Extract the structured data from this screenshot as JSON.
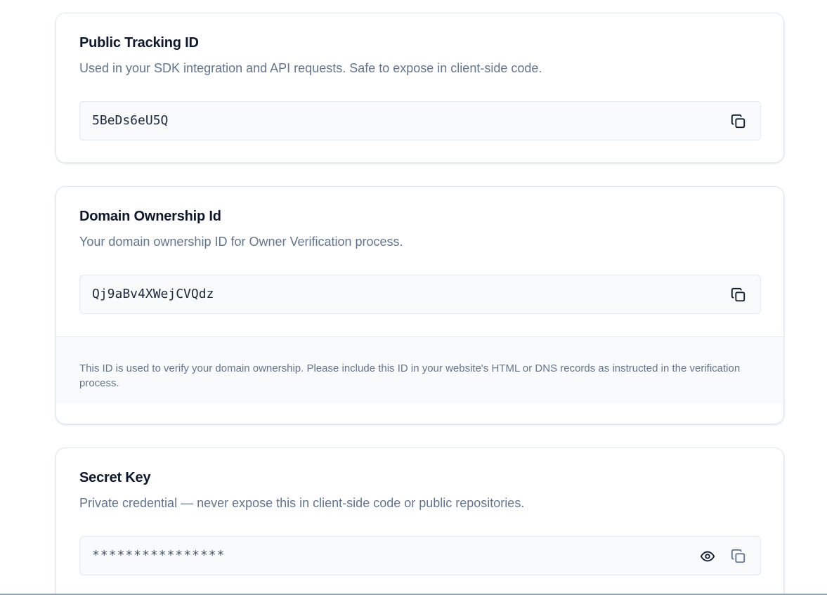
{
  "public_tracking": {
    "title": "Public Tracking ID",
    "description": "Used in your SDK integration and API requests. Safe to expose in client-side code.",
    "value": "5BeDs6eU5Q",
    "copy_icon": "copy-icon"
  },
  "domain_ownership": {
    "title": "Domain Ownership Id",
    "description": "Your domain ownership ID for Owner Verification process.",
    "value": "Qj9aBv4XWejCVQdz",
    "copy_icon": "copy-icon",
    "note": "This ID is used to verify your domain ownership. Please include this ID in your website's HTML or DNS records as instructed in the verification process."
  },
  "secret_key": {
    "title": "Secret Key",
    "description": "Private credential — never expose this in client-side code or public repositories.",
    "value": "****************",
    "reveal_icon": "eye-icon",
    "copy_icon": "copy-icon"
  },
  "colors": {
    "title": "#0f172a",
    "muted_text": "#64748b",
    "field_bg": "#f8fafc",
    "border": "#e2e8f0",
    "icon": "#0f172a",
    "icon_disabled": "#64748b"
  }
}
